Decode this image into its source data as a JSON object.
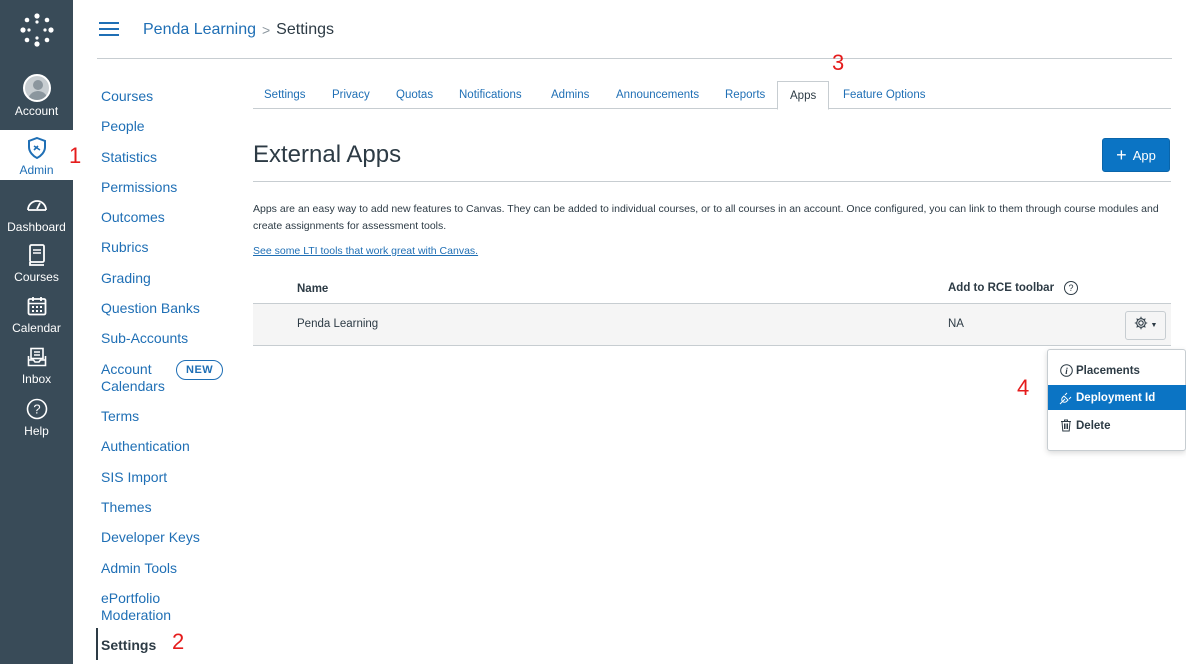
{
  "global_nav": {
    "account": "Account",
    "admin": "Admin",
    "dashboard": "Dashboard",
    "courses": "Courses",
    "calendar": "Calendar",
    "inbox": "Inbox",
    "help": "Help"
  },
  "breadcrumb": {
    "parent": "Penda Learning",
    "separator": ">",
    "current": "Settings"
  },
  "sub_nav": {
    "items": [
      "Courses",
      "People",
      "Statistics",
      "Permissions",
      "Outcomes",
      "Rubrics",
      "Grading",
      "Question Banks",
      "Sub-Accounts",
      "Account",
      "Calendars",
      "Terms",
      "Authentication",
      "SIS Import",
      "Themes",
      "Developer Keys",
      "Admin Tools",
      "ePortfolio",
      "Moderation",
      "Settings"
    ],
    "new_badge": "NEW"
  },
  "tabs": [
    "Settings",
    "Privacy",
    "Quotas",
    "Notifications",
    "Admins",
    "Announcements",
    "Reports",
    "Apps",
    "Feature Options"
  ],
  "main": {
    "title": "External Apps",
    "add_button": "App",
    "description": "Apps are an easy way to add new features to Canvas. They can be added to individual courses, or to all courses in an account. Once configured, you can link to them through course modules and create assignments for assessment tools.",
    "lti_link": "See some LTI tools that work great with Canvas."
  },
  "table": {
    "col_name": "Name",
    "col_rce": "Add to RCE toolbar",
    "help_glyph": "?",
    "rows": [
      {
        "name": "Penda Learning",
        "rce": "NA"
      }
    ]
  },
  "dropdown": {
    "items": [
      "Placements",
      "Deployment Id",
      "Delete"
    ]
  },
  "annotations": [
    "1",
    "2",
    "3",
    "4"
  ],
  "colors": {
    "nav_bg": "#394b58",
    "link": "#1f6fb5",
    "primary_button": "#0b74c4",
    "annotation": "#e51c1c"
  }
}
